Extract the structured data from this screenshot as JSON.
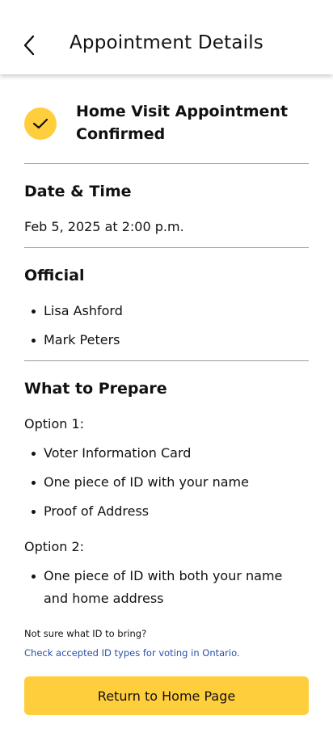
{
  "header": {
    "title": "Appointment Details",
    "back_icon": "chevron-left-icon"
  },
  "confirmation": {
    "icon": "check-icon",
    "accent_color": "#FFCE3D",
    "text": "Home Visit Appointment Confirmed"
  },
  "date_time": {
    "heading": "Date & Time",
    "value": "Feb 5, 2025 at 2:00 p.m."
  },
  "official": {
    "heading": "Official",
    "names": [
      "Lisa Ashford",
      "Mark Peters"
    ]
  },
  "prepare": {
    "heading": "What to Prepare",
    "option1": {
      "label": "Option 1:",
      "items": [
        "Voter Information Card",
        "One piece of ID with your name",
        "Proof of Address"
      ]
    },
    "option2": {
      "label": "Option 2:",
      "items": [
        "One piece of ID with both your name and home address"
      ]
    }
  },
  "help": {
    "note": "Not sure what ID to bring?",
    "link": "Check accepted ID types for voting in Ontario."
  },
  "footer": {
    "button_label": "Return to Home Page"
  }
}
